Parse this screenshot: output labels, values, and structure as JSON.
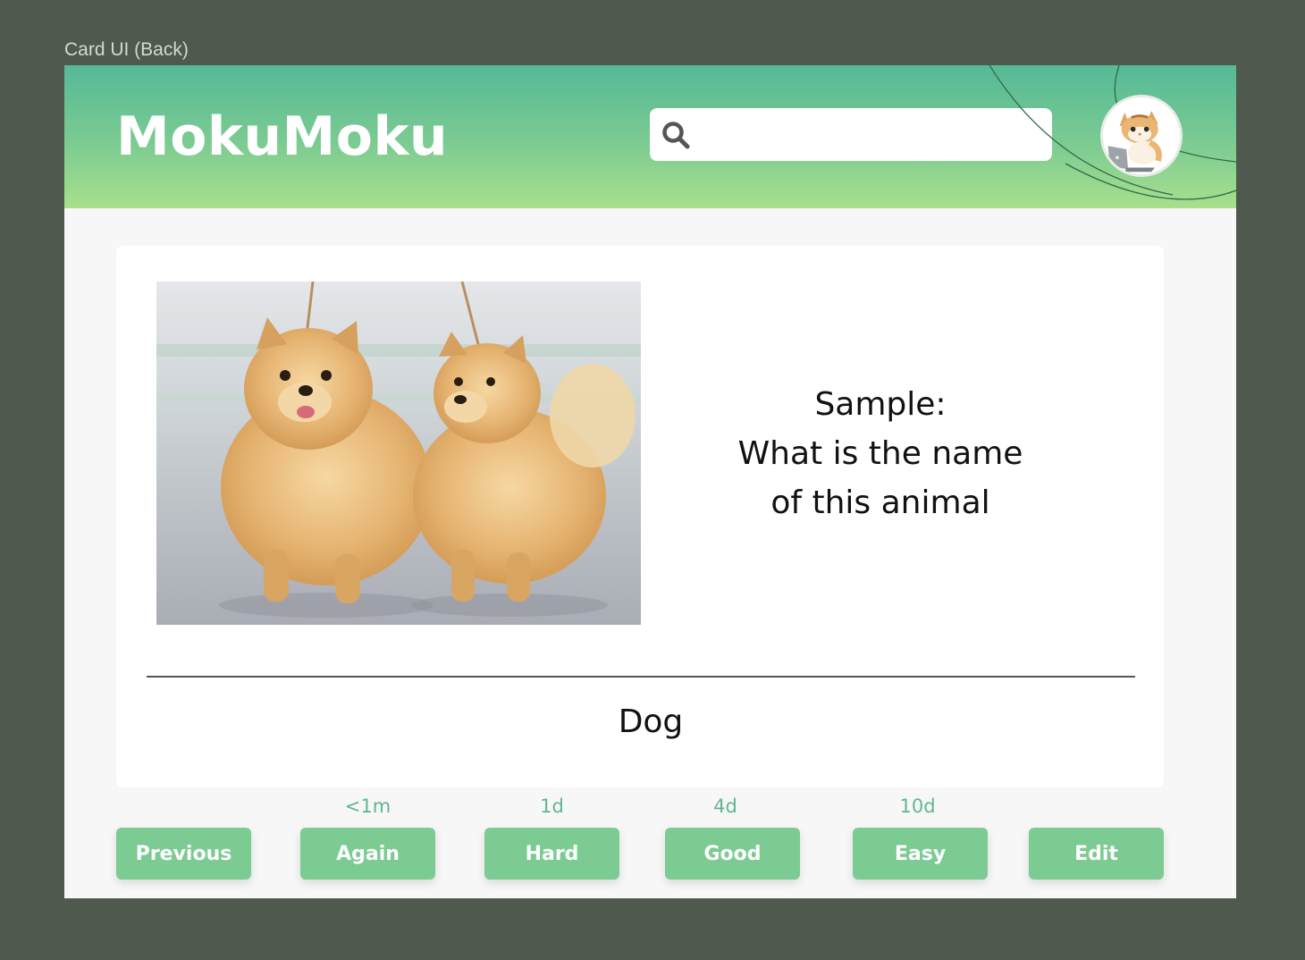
{
  "frame_label": "Card UI (Back)",
  "header": {
    "logo": "MokuMoku",
    "search": {
      "value": "",
      "placeholder": ""
    },
    "search_icon": "search-icon",
    "avatar_icon": "cat-avatar-icon"
  },
  "card": {
    "image_alt": "Two fluffy Pomeranian dogs",
    "question": "Sample:\nWhat is the name\n of this animal",
    "answer": "Dog"
  },
  "intervals": {
    "again": "<1m",
    "hard": "1d",
    "good": "4d",
    "easy": "10d"
  },
  "buttons": {
    "previous": "Previous",
    "again": "Again",
    "hard": "Hard",
    "good": "Good",
    "easy": "Easy",
    "edit": "Edit"
  },
  "colors": {
    "background": "#4f594d",
    "accent": "#7ccb92",
    "header_top": "#55b997",
    "header_bottom": "#a8e08c",
    "interval_text": "#5fb88e"
  }
}
